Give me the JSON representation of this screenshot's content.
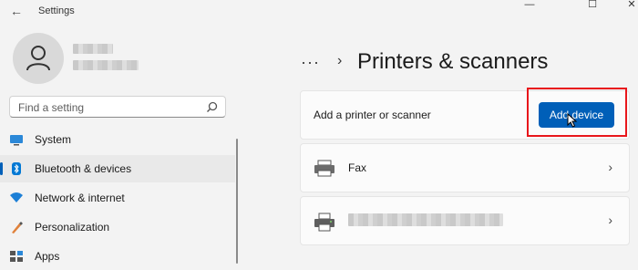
{
  "window": {
    "app_title": "Settings",
    "back_glyph": "←",
    "minimize_glyph": "—",
    "maximize_glyph": "☐",
    "close_glyph": "✕"
  },
  "search": {
    "placeholder": "Find a setting",
    "icon": "search-icon"
  },
  "sidebar": {
    "items": [
      {
        "label": "System",
        "icon": "system-icon"
      },
      {
        "label": "Bluetooth & devices",
        "icon": "bluetooth-icon",
        "selected": true
      },
      {
        "label": "Network & internet",
        "icon": "network-icon"
      },
      {
        "label": "Personalization",
        "icon": "personalization-icon"
      },
      {
        "label": "Apps",
        "icon": "apps-icon"
      }
    ]
  },
  "header": {
    "breadcrumb_dots": "···",
    "breadcrumb_chevron": "›",
    "title": "Printers & scanners"
  },
  "main": {
    "add_card": {
      "label": "Add a printer or scanner",
      "button_label": "Add device"
    },
    "devices": [
      {
        "name": "Fax",
        "icon": "fax-icon",
        "chevron": "›"
      },
      {
        "icon": "printer-icon",
        "chevron": "›"
      }
    ]
  },
  "colors": {
    "accent": "#005fb8",
    "highlight": "#e8161b",
    "background": "#f3f3f3",
    "card": "#fbfbfb"
  }
}
